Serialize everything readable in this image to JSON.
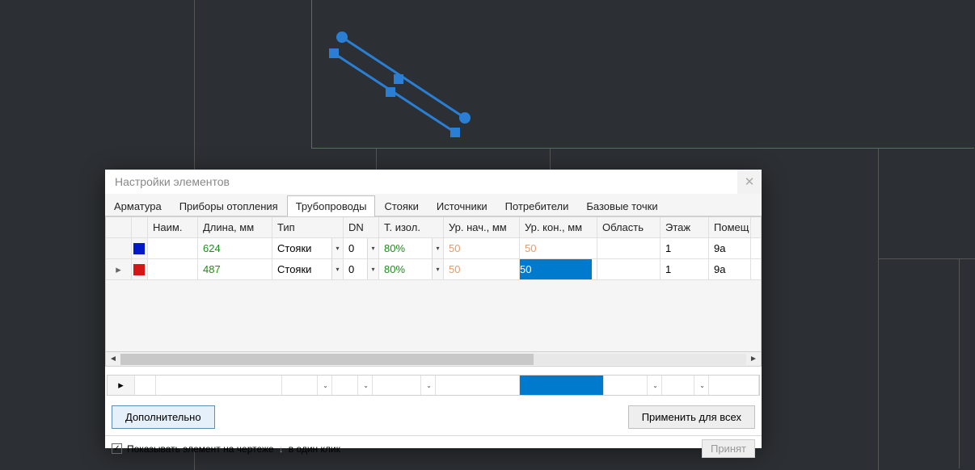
{
  "dialog": {
    "title": "Настройки элементов",
    "tabs": [
      "Арматура",
      "Приборы отопления",
      "Трубопроводы",
      "Стояки",
      "Источники",
      "Потребители",
      "Базовые точки"
    ],
    "active_tab": 2
  },
  "grid": {
    "headers": {
      "name": "Наим.",
      "length": "Длина, мм",
      "type": "Тип",
      "dn": "DN",
      "tiso": "Т. изол.",
      "urnach": "Ур. нач., мм",
      "urkon": "Ур. кон., мм",
      "oblast": "Область",
      "etazh": "Этаж",
      "pomesh": "Помещ"
    },
    "rows": [
      {
        "marker": "",
        "color": "#0018c8",
        "name": "",
        "length": "624",
        "type": "Стояки",
        "dn": "0",
        "tiso": "80%",
        "urnach": "50",
        "urkon": "50",
        "urkon_selected": false,
        "oblast": "",
        "etazh": "1",
        "pomesh": "9a"
      },
      {
        "marker": "▸",
        "color": "#d41616",
        "name": "",
        "length": "487",
        "type": "Стояки",
        "dn": "0",
        "tiso": "80%",
        "urnach": "50",
        "urkon": "50",
        "urkon_selected": true,
        "oblast": "",
        "etazh": "1",
        "pomesh": "9a"
      }
    ]
  },
  "buttons": {
    "additional": "Дополнительно",
    "apply_all": "Применить для всех",
    "accept": "Принят"
  },
  "footer": {
    "show_on_drawing": "Показывать элемент на чертеже",
    "one_click": "в один клик"
  }
}
